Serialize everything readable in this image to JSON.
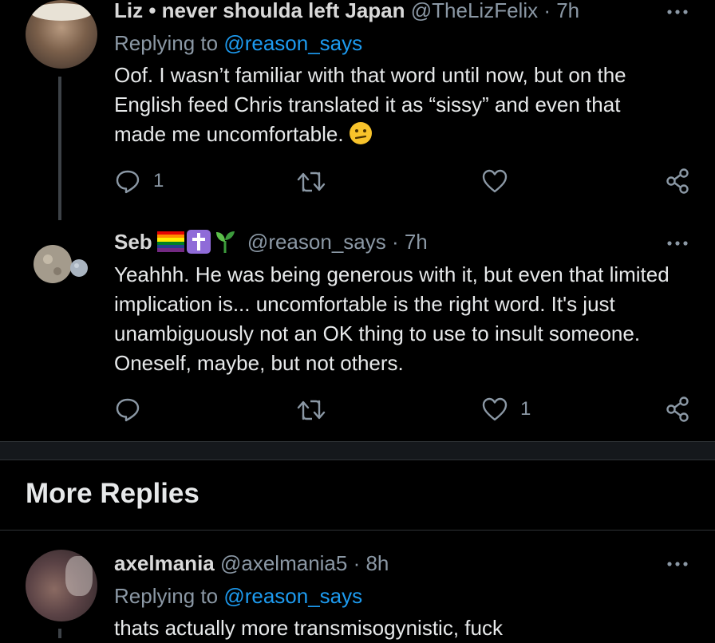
{
  "tweets": [
    {
      "display_name": "Liz • never shoulda left Japan",
      "handle": "@TheLizFelix",
      "time": "· 7h",
      "replying_label": "Replying to",
      "replying_to": "@reason_says",
      "text": "Oof. I wasn’t familiar with that word until now, but on the English feed Chris translated it as “sissy” and even that made me uncomfortable.",
      "emoji": "confused-face",
      "reply_count": "1",
      "retweet_count": "",
      "like_count": ""
    },
    {
      "display_name": "Seb",
      "handle": "@reason_says",
      "time": "· 7h",
      "badges": [
        "rainbow-flag",
        "latin-cross",
        "seedling"
      ],
      "text": "Yeahhh. He was being generous with it, but even that limited implication is... uncomfortable is the right word. It's just unambiguously not an OK thing to use to insult someone. Oneself, maybe, but not others.",
      "reply_count": "",
      "retweet_count": "",
      "like_count": "1"
    },
    {
      "display_name": "axelmania",
      "handle": "@axelmania5",
      "time": "· 8h",
      "replying_label": "Replying to",
      "replying_to": "@reason_says",
      "text": "thats actually more transmisogynistic, fuck"
    }
  ],
  "section": {
    "title": "More Replies"
  },
  "colors": {
    "background": "#000000",
    "accent": "#1d9bf0",
    "muted": "#8b98a5"
  },
  "icons": [
    "reply-icon",
    "retweet-icon",
    "like-icon",
    "share-icon",
    "more-icon"
  ]
}
